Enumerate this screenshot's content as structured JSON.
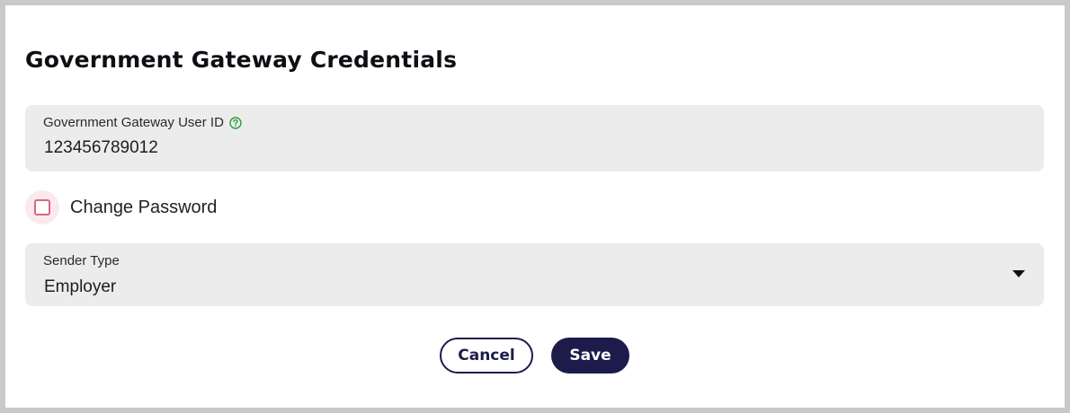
{
  "dialog": {
    "title": "Government Gateway Credentials"
  },
  "user_id_field": {
    "label": "Government Gateway User ID",
    "value": "123456789012",
    "help_icon": "question-circle-icon"
  },
  "change_password": {
    "label": "Change Password",
    "checked": false
  },
  "sender_type": {
    "label": "Sender Type",
    "value": "Employer",
    "icon": "caret-down-icon"
  },
  "actions": {
    "cancel_label": "Cancel",
    "save_label": "Save"
  },
  "colors": {
    "primary": "#1d1b4c",
    "help_icon": "#2e9a3a",
    "checkbox_border": "#d9667f",
    "field_bg": "#ececec"
  }
}
